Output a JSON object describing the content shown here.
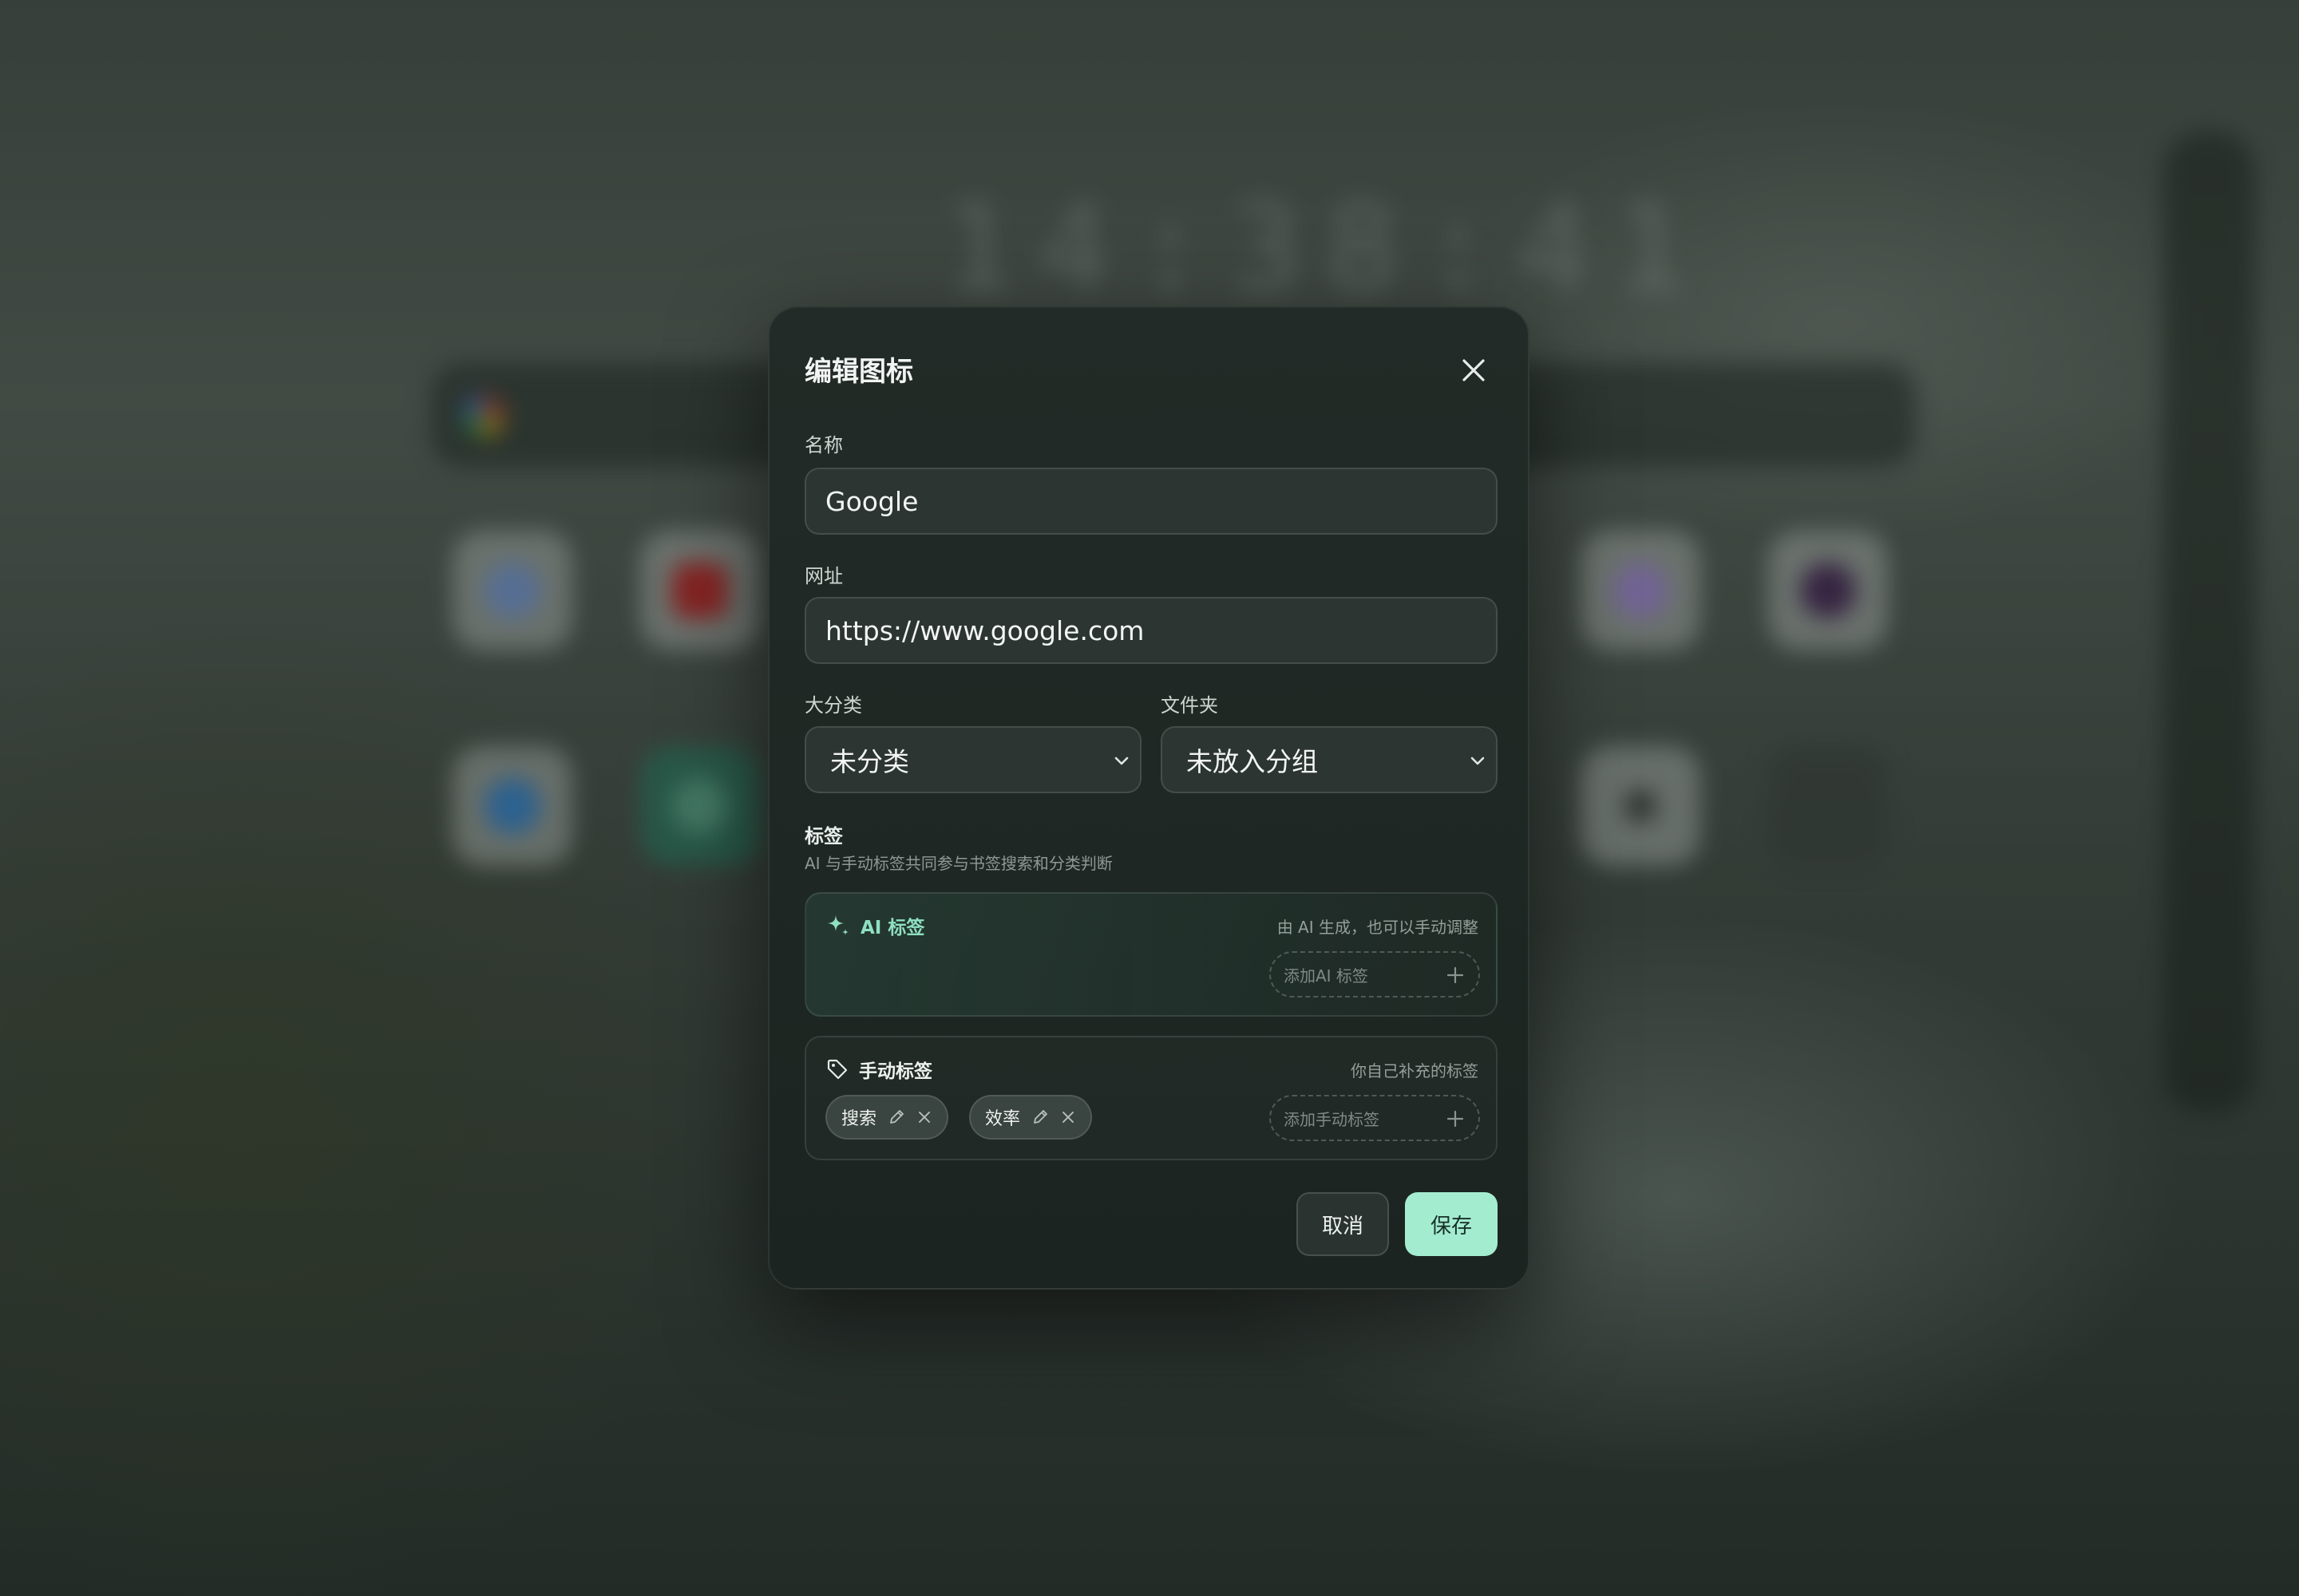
{
  "background": {
    "clock": "14:38:41"
  },
  "dialog": {
    "title": "编辑图标",
    "name": {
      "label": "名称",
      "value": "Google"
    },
    "url": {
      "label": "网址",
      "value": "https://www.google.com"
    },
    "category": {
      "label": "大分类",
      "selected": "未分类"
    },
    "folder": {
      "label": "文件夹",
      "selected": "未放入分组"
    },
    "tags": {
      "title": "标签",
      "subtitle": "AI 与手动标签共同参与书签搜索和分类判断",
      "ai": {
        "title": "AI 标签",
        "hint": "由 AI 生成，也可以手动调整",
        "add_placeholder": "添加AI 标签"
      },
      "manual": {
        "title": "手动标签",
        "hint": "你自己补充的标签",
        "add_placeholder": "添加手动标签",
        "items": [
          "搜索",
          "效率"
        ]
      }
    },
    "cancel_label": "取消",
    "save_label": "保存"
  },
  "colors": {
    "accent": "#a4ecd0",
    "ai_accent": "#8fe0c2",
    "panel": "#1f2724"
  }
}
